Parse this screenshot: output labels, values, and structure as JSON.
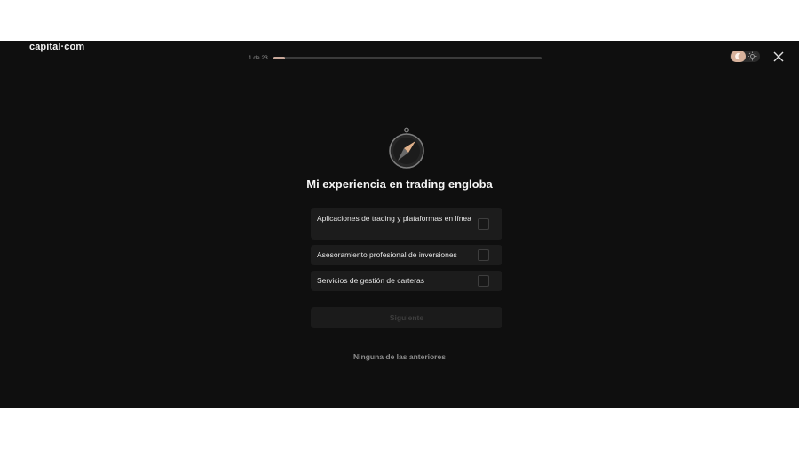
{
  "brand": {
    "logo_text": "capital·com"
  },
  "progress": {
    "label": "1 de 23",
    "fraction": 0.043
  },
  "icons": {
    "theme_dark": "moon-icon",
    "theme_light": "sun-icon",
    "close": "close-icon",
    "hero": "compass-icon"
  },
  "colors": {
    "background": "#0f0f0f",
    "accent": "#d8b29c",
    "card": "#1c1c1c"
  },
  "question": {
    "title": "Mi experiencia en trading engloba"
  },
  "options": [
    {
      "label": "Aplicaciones de trading y plataformas en línea",
      "checked": false
    },
    {
      "label": "Asesoramiento profesional de inversiones",
      "checked": false
    },
    {
      "label": "Servicios de gestión de carteras",
      "checked": false
    }
  ],
  "actions": {
    "next_label": "Siguiente",
    "none_label": "Ninguna de las anteriores"
  }
}
